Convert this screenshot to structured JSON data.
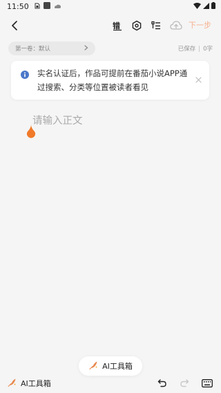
{
  "status_bar": {
    "time": "11:50"
  },
  "app_bar": {
    "next_label": "下一步",
    "toolbar_icons": [
      "typo-check-icon",
      "settings-icon",
      "outline-icon",
      "cloud-upload-icon"
    ]
  },
  "volume": {
    "label": "第一卷：默认"
  },
  "save_status": {
    "saved_label": "已保存",
    "word_count": "0字"
  },
  "notice": {
    "text": "实名认证后，作品可提前在番茄小说APP通过搜索、分类等位置被读者看见"
  },
  "editor": {
    "placeholder": "请输入正文"
  },
  "ai_toolbox": {
    "float_label": "AI工具箱",
    "bar_label": "AI工具箱"
  },
  "colors": {
    "accent": "#f7b08e",
    "cursor": "#f07a2a",
    "info_icon": "#4a78c9",
    "background": "#f5f5f5"
  }
}
